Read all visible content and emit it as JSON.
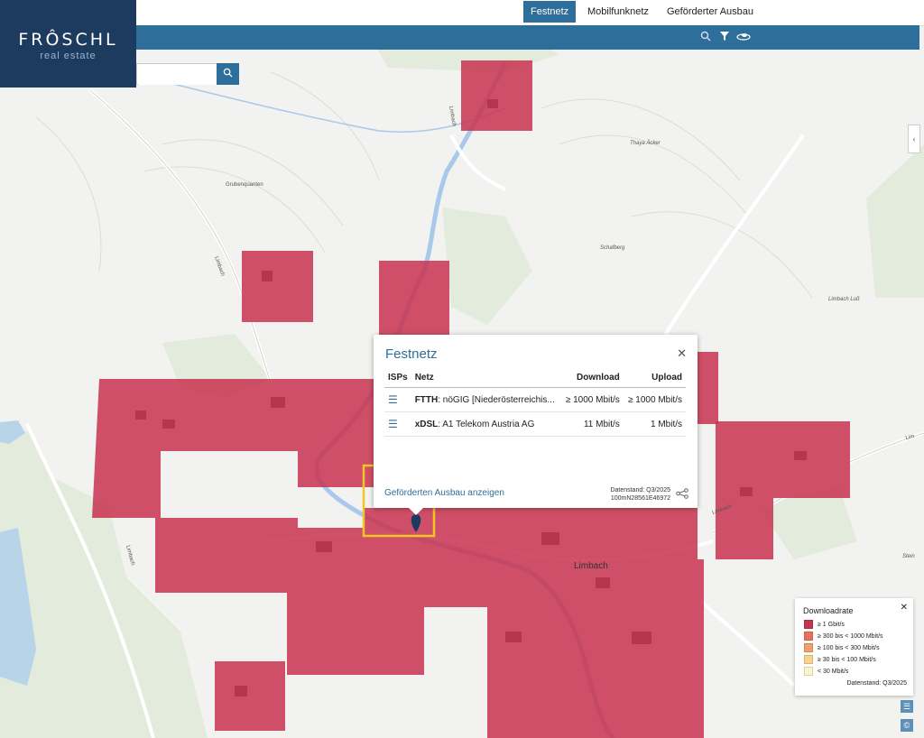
{
  "nav": {
    "tabs": [
      {
        "label": "Festnetz",
        "active": true
      },
      {
        "label": "Mobilfunknetz",
        "active": false
      },
      {
        "label": "Geförderter Ausbau",
        "active": false
      }
    ]
  },
  "toolbar": {
    "icons": [
      "search-icon",
      "filter-icon",
      "layers-icon"
    ]
  },
  "logo": {
    "brand": "FRÔSCHL",
    "sub": "real estate"
  },
  "search": {
    "value": "",
    "button_icon": "search-icon"
  },
  "map_labels": {
    "place1": "Grubenquanten",
    "place2": "Thaya Äcker",
    "place3": "Schafberg",
    "place4": "Limbach Luß",
    "place5": "Stein",
    "road1": "Limbach",
    "road2": "Limbach",
    "road3": "Limbach",
    "town": "Limbach",
    "road4": "Limbach",
    "road_right": "Lim"
  },
  "popup": {
    "title": "Festnetz",
    "columns": [
      "ISPs",
      "Netz",
      "Download",
      "Upload"
    ],
    "rows": [
      {
        "tech": "FTTH",
        "provider": ": nöGIG [Niederösterreichis...",
        "download": "≥ 1000 Mbit/s",
        "upload": "≥ 1000 Mbit/s"
      },
      {
        "tech": "xDSL",
        "provider": ": A1 Telekom Austria AG",
        "download": "11 Mbit/s",
        "upload": "1 Mbit/s"
      }
    ],
    "link": "Geförderten Ausbau anzeigen",
    "data_date": "Datenstand: Q3/2025",
    "cell_id": "100mN28561E46972"
  },
  "legend": {
    "title": "Downloadrate",
    "items": [
      {
        "label": "≥ 1 Gbit/s",
        "color": "#c8334f"
      },
      {
        "label": "≥ 300 bis < 1000 Mbit/s",
        "color": "#e8715c"
      },
      {
        "label": "≥ 100 bis < 300 Mbit/s",
        "color": "#f0a06b"
      },
      {
        "label": "≥ 30 bis < 100 Mbit/s",
        "color": "#f6d48c"
      },
      {
        "label": "< 30 Mbit/s",
        "color": "#fbf6c9"
      }
    ],
    "date": "Datenstand: Q3/2025"
  },
  "colors": {
    "primary": "#2d6e9a",
    "coverage": "#c8334f",
    "highlight": "#f3c623"
  }
}
